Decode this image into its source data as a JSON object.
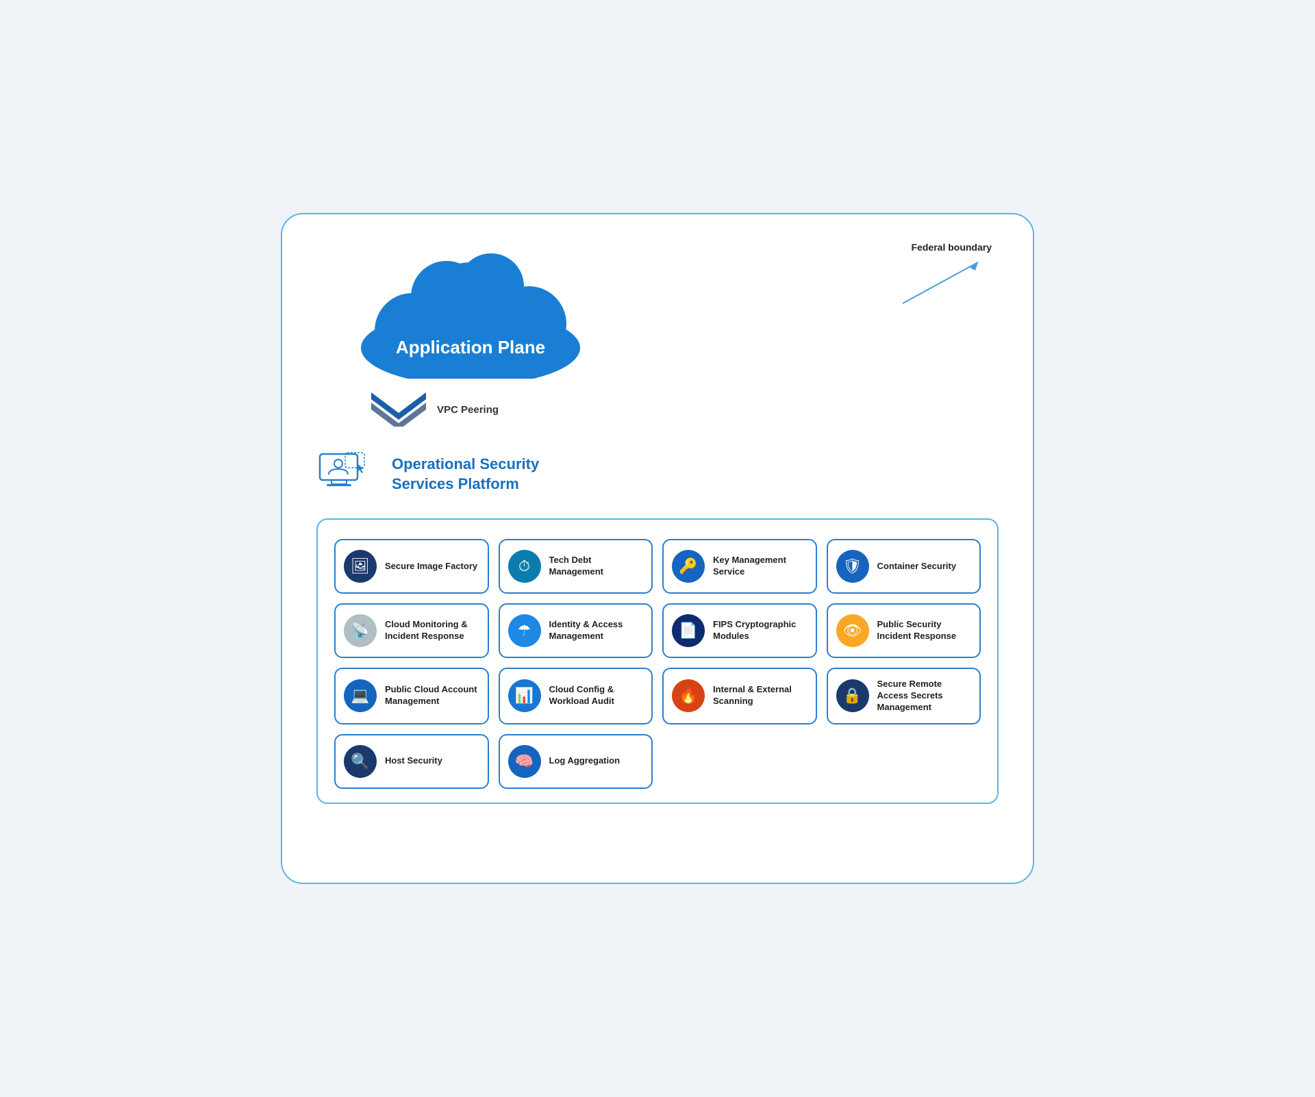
{
  "page": {
    "federal_boundary_label": "Federal boundary",
    "cloud_label": "Application Plane",
    "vpc_label": "VPC Peering",
    "ops_title": "Operational Security Services Platform",
    "services": [
      {
        "id": "secure-image-factory",
        "label": "Secure Image Factory",
        "icon": "🖼",
        "icon_class": "ic-dark-blue"
      },
      {
        "id": "tech-debt-management",
        "label": "Tech Debt Management",
        "icon": "⏱",
        "icon_class": "ic-teal"
      },
      {
        "id": "key-management-service",
        "label": "Key Management Service",
        "icon": "🔑",
        "icon_class": "ic-mid-blue"
      },
      {
        "id": "container-security",
        "label": "Container Security",
        "icon": "🛡",
        "icon_class": "ic-mid-blue"
      },
      {
        "id": "cloud-monitoring",
        "label": "Cloud Monitoring & Incident Response",
        "icon": "📡",
        "icon_class": "ic-gray"
      },
      {
        "id": "identity-access-management",
        "label": "Identity & Access Management",
        "icon": "☂",
        "icon_class": "ic-light-blue"
      },
      {
        "id": "fips-cryptographic",
        "label": "FIPS Cryptographic Modules",
        "icon": "📄",
        "icon_class": "ic-navy"
      },
      {
        "id": "public-security-incident",
        "label": "Public Security Incident Response",
        "icon": "👁",
        "icon_class": "ic-gold"
      },
      {
        "id": "public-cloud-account",
        "label": "Public Cloud Account Management",
        "icon": "💻",
        "icon_class": "ic-blue2"
      },
      {
        "id": "cloud-config-workload",
        "label": "Cloud Config & Workload Audit",
        "icon": "📊",
        "icon_class": "ic-chart"
      },
      {
        "id": "internal-external-scanning",
        "label": "Internal & External Scanning",
        "icon": "🔥",
        "icon_class": "ic-fire"
      },
      {
        "id": "secure-remote-access",
        "label": "Secure Remote Access Secrets Management",
        "icon": "🔒",
        "icon_class": "ic-lock"
      },
      {
        "id": "host-security",
        "label": "Host Security",
        "icon": "🔍",
        "icon_class": "ic-fingerprint"
      },
      {
        "id": "log-aggregation",
        "label": "Log Aggregation",
        "icon": "🧠",
        "icon_class": "ic-brain"
      }
    ]
  }
}
